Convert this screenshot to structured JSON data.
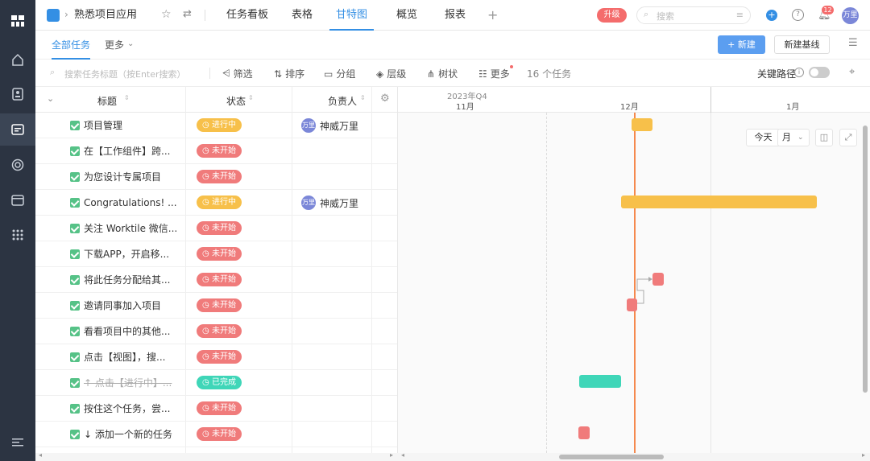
{
  "header": {
    "project_name": "熟悉项目应用",
    "tabs": [
      "任务看板",
      "表格",
      "甘特图",
      "概览",
      "报表"
    ],
    "active_tab": "甘特图",
    "upgrade_label": "升级",
    "search_placeholder": "搜索",
    "notification_count": "12",
    "avatar_text": "万里"
  },
  "subbar": {
    "all_tasks": "全部任务",
    "more": "更多",
    "new_button": "+ 新建",
    "baseline_button": "新建基线"
  },
  "toolbar": {
    "search_placeholder": "搜索任务标题（按Enter搜索）",
    "filter": "筛选",
    "sort": "排序",
    "group": "分组",
    "level": "层级",
    "tree": "树状",
    "more": "更多",
    "task_count": "16 个任务",
    "critical_path": "关键路径"
  },
  "columns": {
    "title": "标题",
    "status": "状态",
    "owner": "负责人"
  },
  "tasks": [
    {
      "title": "项目管理",
      "status": "进行中",
      "owner": "神威万里",
      "done": false
    },
    {
      "title": "在【工作组件】跨...",
      "status": "未开始",
      "owner": "",
      "done": false
    },
    {
      "title": "为您设计专属项目",
      "status": "未开始",
      "owner": "",
      "done": false
    },
    {
      "title": "Congratulations! ...",
      "status": "进行中",
      "owner": "神威万里",
      "done": false
    },
    {
      "title": "关注 Worktile 微信...",
      "status": "未开始",
      "owner": "",
      "done": false
    },
    {
      "title": "下载APP，开启移...",
      "status": "未开始",
      "owner": "",
      "done": false
    },
    {
      "title": "将此任务分配给其...",
      "status": "未开始",
      "owner": "",
      "done": false
    },
    {
      "title": "邀请同事加入项目",
      "status": "未开始",
      "owner": "",
      "done": false
    },
    {
      "title": "看看项目中的其他...",
      "status": "未开始",
      "owner": "",
      "done": false
    },
    {
      "title": "点击【视图】，搜...",
      "status": "未开始",
      "owner": "",
      "done": false
    },
    {
      "title": "↑ 点击【进行中】...",
      "status": "已完成",
      "owner": "",
      "done": true
    },
    {
      "title": "按住这个任务，尝...",
      "status": "未开始",
      "owner": "",
      "done": false
    },
    {
      "title": "↓ 添加一个新的任务",
      "status": "未开始",
      "owner": "",
      "done": false
    }
  ],
  "owner_avatar": "万里",
  "gantt": {
    "quarter": "2023年Q4",
    "months": [
      "11月",
      "12月",
      "1月"
    ],
    "today_button": "今天",
    "scale_select": "月"
  },
  "colors": {
    "in_progress": "#f7c04a",
    "not_started": "#f07b7b",
    "done": "#3fd6b8",
    "accent": "#348fe4",
    "today_line": "#f5894e"
  }
}
